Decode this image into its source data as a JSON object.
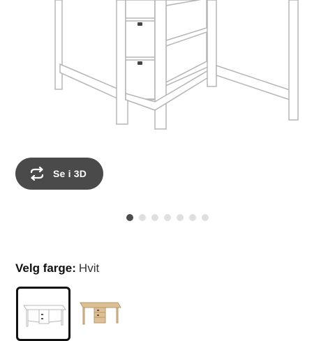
{
  "viewer": {
    "view_3d_label": "Se i 3D",
    "icon": "rotate-arrows-icon",
    "slides_count": 7,
    "active_slide": 1
  },
  "color_picker": {
    "label": "Velg farge:",
    "value": "Hvit",
    "options": [
      {
        "name": "white-table-swatch",
        "color": "#ffffff",
        "selected": true
      },
      {
        "name": "birch-table-swatch",
        "color": "#d9b98a",
        "selected": false
      }
    ]
  },
  "colors": {
    "button_bg": "#4a4a4a",
    "dot_active": "#4d4d4d",
    "dot_inactive": "#dfdfdf",
    "product_outline": "#b5b5b5"
  }
}
